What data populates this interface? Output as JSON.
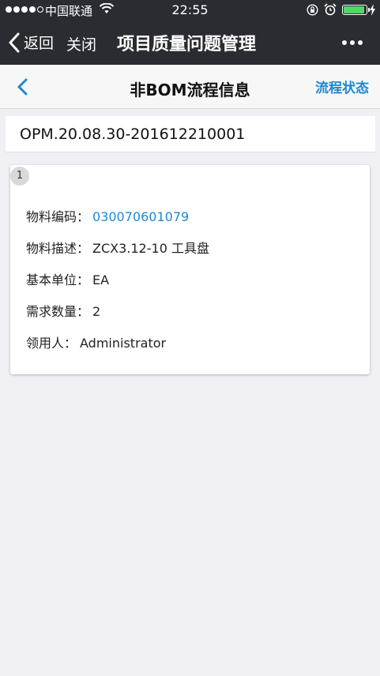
{
  "status_bar": {
    "carrier": "中国联通",
    "time": "22:55",
    "battery_color": "#4cd964"
  },
  "wechat_nav": {
    "back_label": "返回",
    "close_label": "关闭",
    "title": "项目质量问题管理"
  },
  "page": {
    "title": "非BOM流程信息",
    "status_link": "流程状态",
    "doc_number": "OPM.20.08.30-201612210001"
  },
  "item": {
    "index": "1",
    "fields": [
      {
        "label": "物料编码：",
        "value": "030070601079"
      },
      {
        "label": "物料描述：",
        "value": "ZCX3.12-10 工具盘"
      },
      {
        "label": "基本单位：",
        "value": "EA"
      },
      {
        "label": "需求数量：",
        "value": "2"
      },
      {
        "label": "领用人：",
        "value": "Administrator"
      }
    ]
  },
  "colors": {
    "accent": "#1e88d2",
    "topbar": "#2b2c31",
    "background": "#efeff4"
  },
  "icons": [
    "signal-icon",
    "wifi-icon",
    "lock-rotation-icon",
    "alarm-icon",
    "battery-icon",
    "charging-icon",
    "chevron-left-icon",
    "more-icon"
  ]
}
